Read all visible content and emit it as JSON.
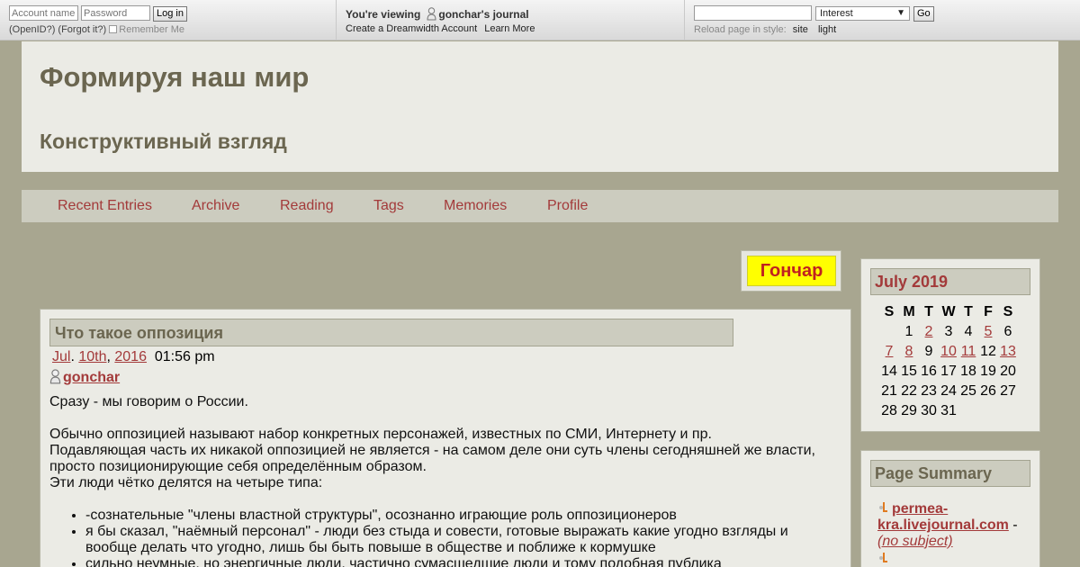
{
  "topbar": {
    "login": {
      "account_placeholder": "Account name:",
      "password_placeholder": "Password",
      "login_button": "Log in",
      "openid": "(OpenID?)",
      "forgot": "(Forgot it?)",
      "remember": "Remember Me"
    },
    "viewing": {
      "prefix": "You're viewing",
      "journal": "gonchar's journal",
      "create": "Create a Dreamwidth Account",
      "learn": "Learn More"
    },
    "search": {
      "select_value": "Interest",
      "go": "Go",
      "reload_label": "Reload page in style:",
      "style_site": "site",
      "style_light": "light"
    }
  },
  "header": {
    "title": "Формируя наш мир",
    "subtitle": "Конструктивный взгляд"
  },
  "nav": [
    "Recent Entries",
    "Archive",
    "Reading",
    "Tags",
    "Memories",
    "Profile"
  ],
  "userpic_text": "Гончар",
  "entry": {
    "title": "Что такое оппозиция",
    "date_month": "Jul",
    "date_day": "10th",
    "date_year": "2016",
    "time": "01:56 pm",
    "author": "gonchar",
    "p1": "Сразу - мы говорим о России.",
    "p2": "Обычно оппозицией называют набор конкретных персонажей, известных по СМИ, Интернету и пр.",
    "p3": "Подавляющая часть их никакой оппозицией не является - на самом деле они суть члены сегодняшней же власти, просто позиционирующие себя определённым образом.",
    "p4": "Эти люди чётко делятся на четыре типа:",
    "list": [
      "-сознательные \"члены властной структуры\", осознанно играющие роль оппозиционеров",
      "я бы сказал, \"наёмный персонал\" - люди без стыда и совести, готовые выражать какие угодно взгляды и вообще делать что угодно, лишь бы быть повыше в обществе и поближе к кормушке",
      "сильно неумные, но энергичные люди, частично сумасшедшие люди и тому подобная публика"
    ]
  },
  "calendar": {
    "title": "July 2019",
    "weekdays": [
      "S",
      "M",
      "T",
      "W",
      "T",
      "F",
      "S"
    ],
    "weeks": [
      [
        "",
        "1",
        "2",
        "3",
        "4",
        "5",
        "6"
      ],
      [
        "7",
        "8",
        "9",
        "10",
        "11",
        "12",
        "13"
      ],
      [
        "14",
        "15",
        "16",
        "17",
        "18",
        "19",
        "20"
      ],
      [
        "21",
        "22",
        "23",
        "24",
        "25",
        "26",
        "27"
      ],
      [
        "28",
        "29",
        "30",
        "31",
        "",
        "",
        ""
      ]
    ],
    "linked_days": [
      "2",
      "5",
      "7",
      "8",
      "10",
      "11",
      "13"
    ]
  },
  "summary": {
    "title": "Page Summary",
    "item1_link": "permea-kra.livejournal.com",
    "item1_sep": " - ",
    "item1_subject": "(no subject)"
  },
  "colors": {
    "background": "#a8a690",
    "accent_link": "#a33a3a",
    "heading": "#6b6650",
    "panel": "#ebebe5",
    "bar": "#ccccbf"
  }
}
